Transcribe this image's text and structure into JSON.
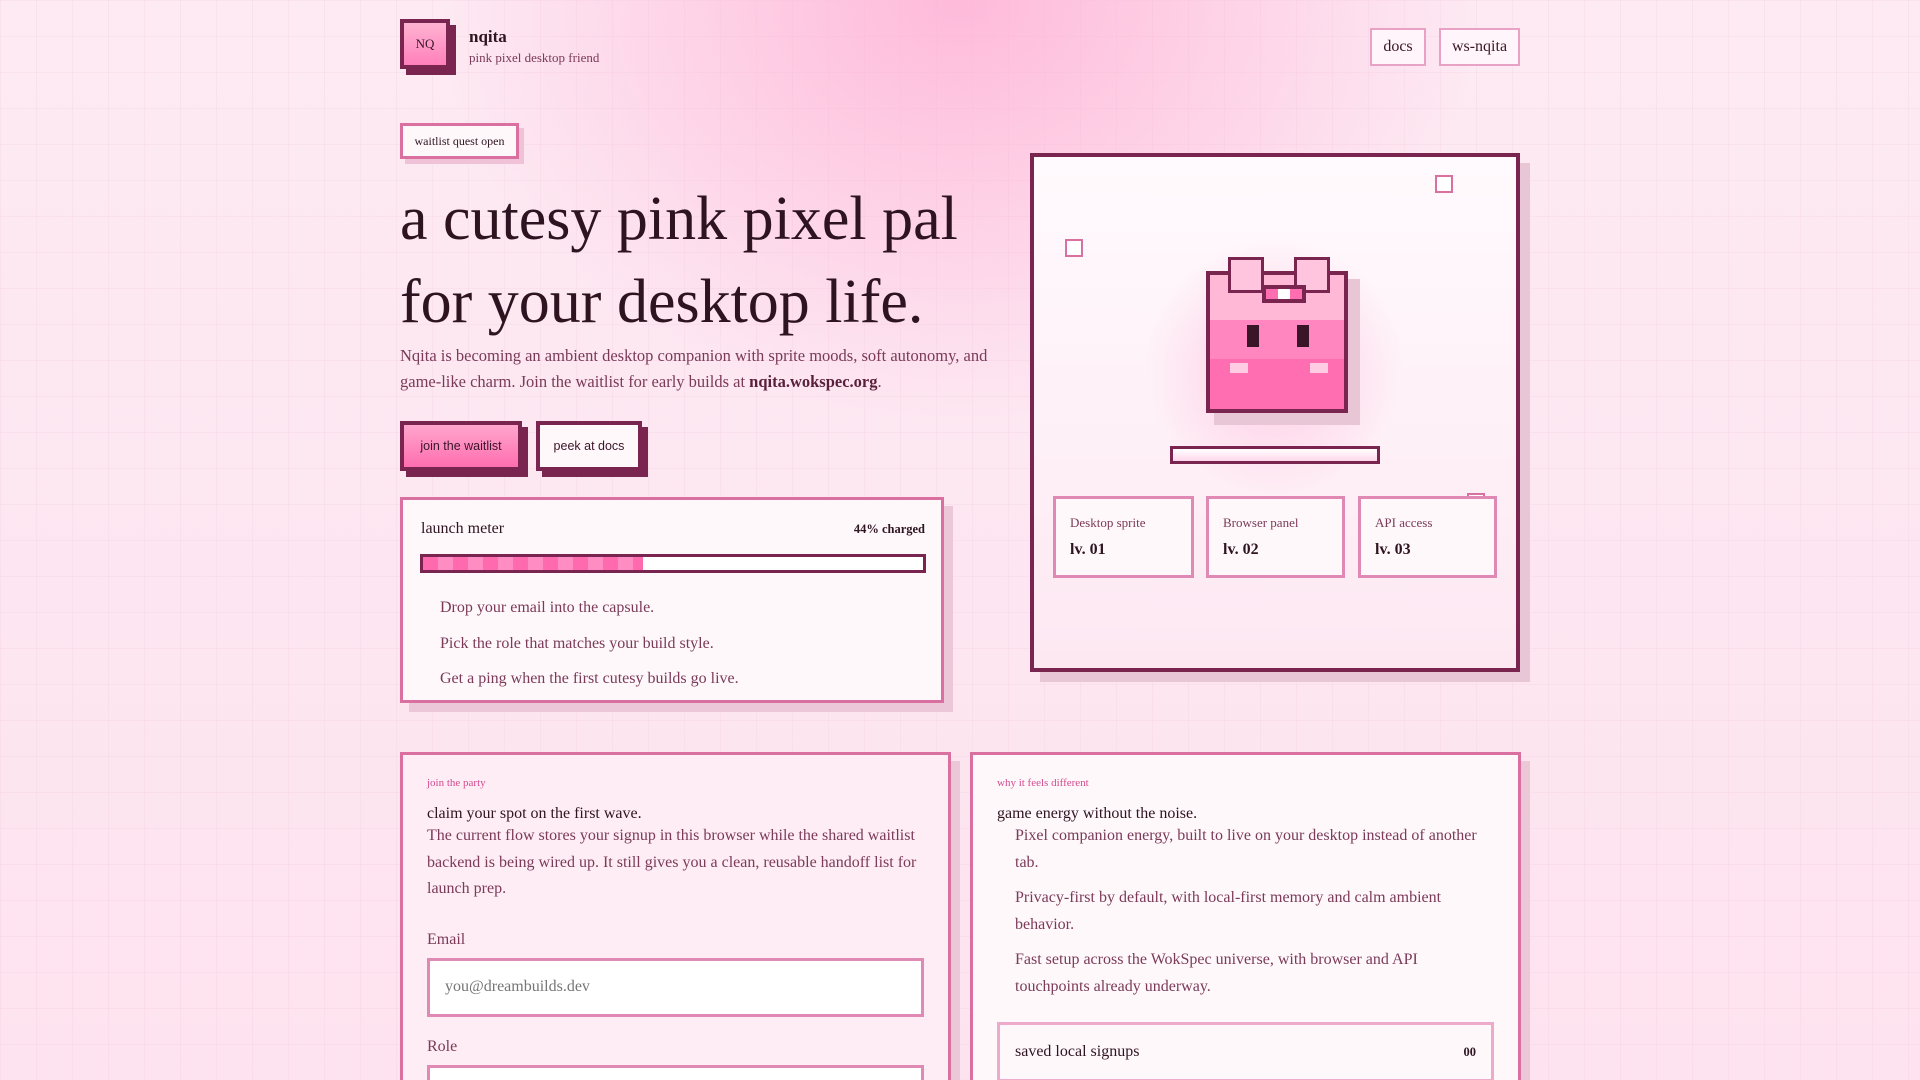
{
  "header": {
    "logo_text": "NQ",
    "title": "nqita",
    "subtitle": "pink pixel desktop friend",
    "nav": [
      "docs",
      "ws-nqita"
    ]
  },
  "hero": {
    "badge": "waitlist quest open",
    "headline_line1": "a cutesy pink pixel pal",
    "headline_line2": "for your desktop life.",
    "lead_text": "Nqita is becoming an ambient desktop companion with sprite moods, soft autonomy, and game-like charm. Join the waitlist for early builds at ",
    "lead_link": "nqita.wokspec.org",
    "lead_end": ".",
    "primary_button": "join the waitlist",
    "secondary_button": "peek at docs"
  },
  "meter": {
    "title": "launch meter",
    "value_label": "44% charged",
    "percent": 44,
    "steps": [
      "Drop your email into the capsule.",
      "Pick the role that matches your build style.",
      "Get a ping when the first cutesy builds go live."
    ]
  },
  "panel": {
    "features": [
      {
        "label": "Desktop sprite",
        "level": "lv. 01"
      },
      {
        "label": "Browser panel",
        "level": "lv. 02"
      },
      {
        "label": "API access",
        "level": "lv. 03"
      }
    ]
  },
  "join": {
    "eyebrow": "join the party",
    "title": "claim your spot on the first wave.",
    "text": "The current flow stores your signup in this browser while the shared waitlist backend is being wired up. It still gives you a clean, reusable handoff list for launch prep.",
    "email_label": "Email",
    "email_placeholder": "you@dreambuilds.dev",
    "role_label": "Role"
  },
  "why": {
    "eyebrow": "why it feels different",
    "title": "game energy without the noise.",
    "points": [
      "Pixel companion energy, built to live on your desktop instead of another tab.",
      "Privacy-first by default, with local-first memory and calm ambient behavior.",
      "Fast setup across the WokSpec universe, with browser and API touchpoints already underway."
    ],
    "saved_label": "saved local signups",
    "saved_count": "00"
  },
  "colors": {
    "accent": "#ff6eb0",
    "border_dark": "#7a2550",
    "border_pink": "#d9709f",
    "text": "#2e1420"
  }
}
